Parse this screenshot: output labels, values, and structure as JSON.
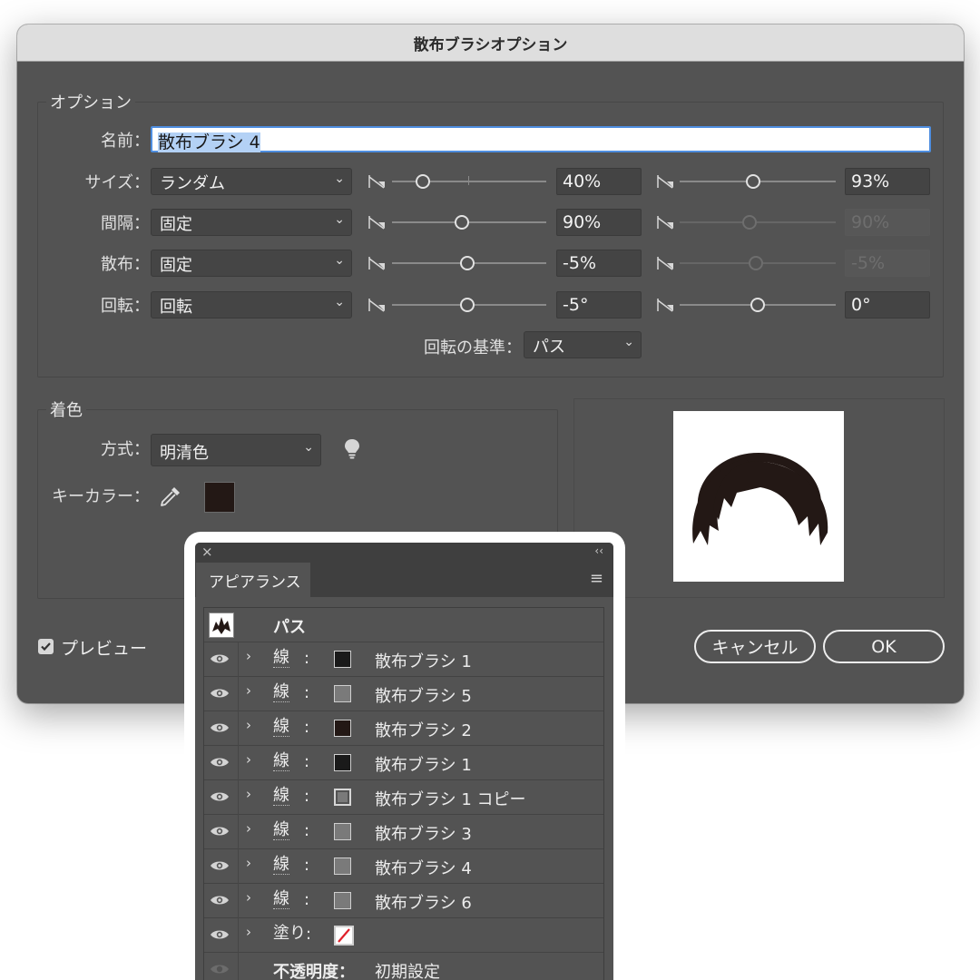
{
  "dialog": {
    "title": "散布ブラシオプション",
    "options_legend": "オプション",
    "name_label": "名前：",
    "name_value": "散布ブラシ 4",
    "rows": [
      {
        "label": "サイズ：",
        "mode": "ランダム",
        "min_value": "40%",
        "max_value": "93%",
        "min_level": 0.2,
        "max_level": 0.47,
        "max_disabled": false
      },
      {
        "label": "間隔：",
        "mode": "固定",
        "min_value": "90%",
        "max_value": "90%",
        "min_level": 0.45,
        "max_level": 0.45,
        "max_disabled": true
      },
      {
        "label": "散布：",
        "mode": "固定",
        "min_value": "-5%",
        "max_value": "-5%",
        "min_level": 0.49,
        "max_level": 0.49,
        "max_disabled": true
      },
      {
        "label": "回転：",
        "mode": "回転",
        "min_value": "-5°",
        "max_value": "0°",
        "min_level": 0.49,
        "max_level": 0.5,
        "max_disabled": false
      }
    ],
    "rotation_basis_label": "回転の基準：",
    "rotation_basis_value": "パス",
    "coloring_legend": "着色",
    "method_label": "方式：",
    "method_value": "明清色",
    "key_color_label": "キーカラー：",
    "key_color": "#231815",
    "preview_label": "プレビュー",
    "preview_checked": true,
    "cancel_label": "キャンセル",
    "ok_label": "OK"
  },
  "appearance": {
    "close_glyph": "×",
    "collapse_glyph": "‹‹",
    "tab_label": "アピアランス",
    "menu_glyph": "≡",
    "header_label": "パス",
    "rows": [
      {
        "kind": "線",
        "swatch": "#1a1a1a",
        "name": "散布ブラシ 1",
        "eye": true
      },
      {
        "kind": "線",
        "swatch": "#7a7a7a",
        "name": "散布ブラシ 5",
        "eye": true
      },
      {
        "kind": "線",
        "swatch": "#231815",
        "name": "散布ブラシ 2",
        "eye": true
      },
      {
        "kind": "線",
        "swatch": "#1a1a1a",
        "name": "散布ブラシ 1",
        "eye": true
      },
      {
        "kind": "線",
        "swatch": "#7a7a7a",
        "name": "散布ブラシ 1 コピー",
        "eye": true,
        "highlight": true
      },
      {
        "kind": "線",
        "swatch": "#7a7a7a",
        "name": "散布ブラシ 3",
        "eye": true
      },
      {
        "kind": "線",
        "swatch": "#7a7a7a",
        "name": "散布ブラシ 4",
        "eye": true
      },
      {
        "kind": "線",
        "swatch": "#7a7a7a",
        "name": "散布ブラシ 6",
        "eye": true
      }
    ],
    "fill_row": {
      "kind": "塗り",
      "swatch": "none"
    },
    "opacity_row": {
      "kind": "不透明度：",
      "value": "初期設定"
    }
  }
}
